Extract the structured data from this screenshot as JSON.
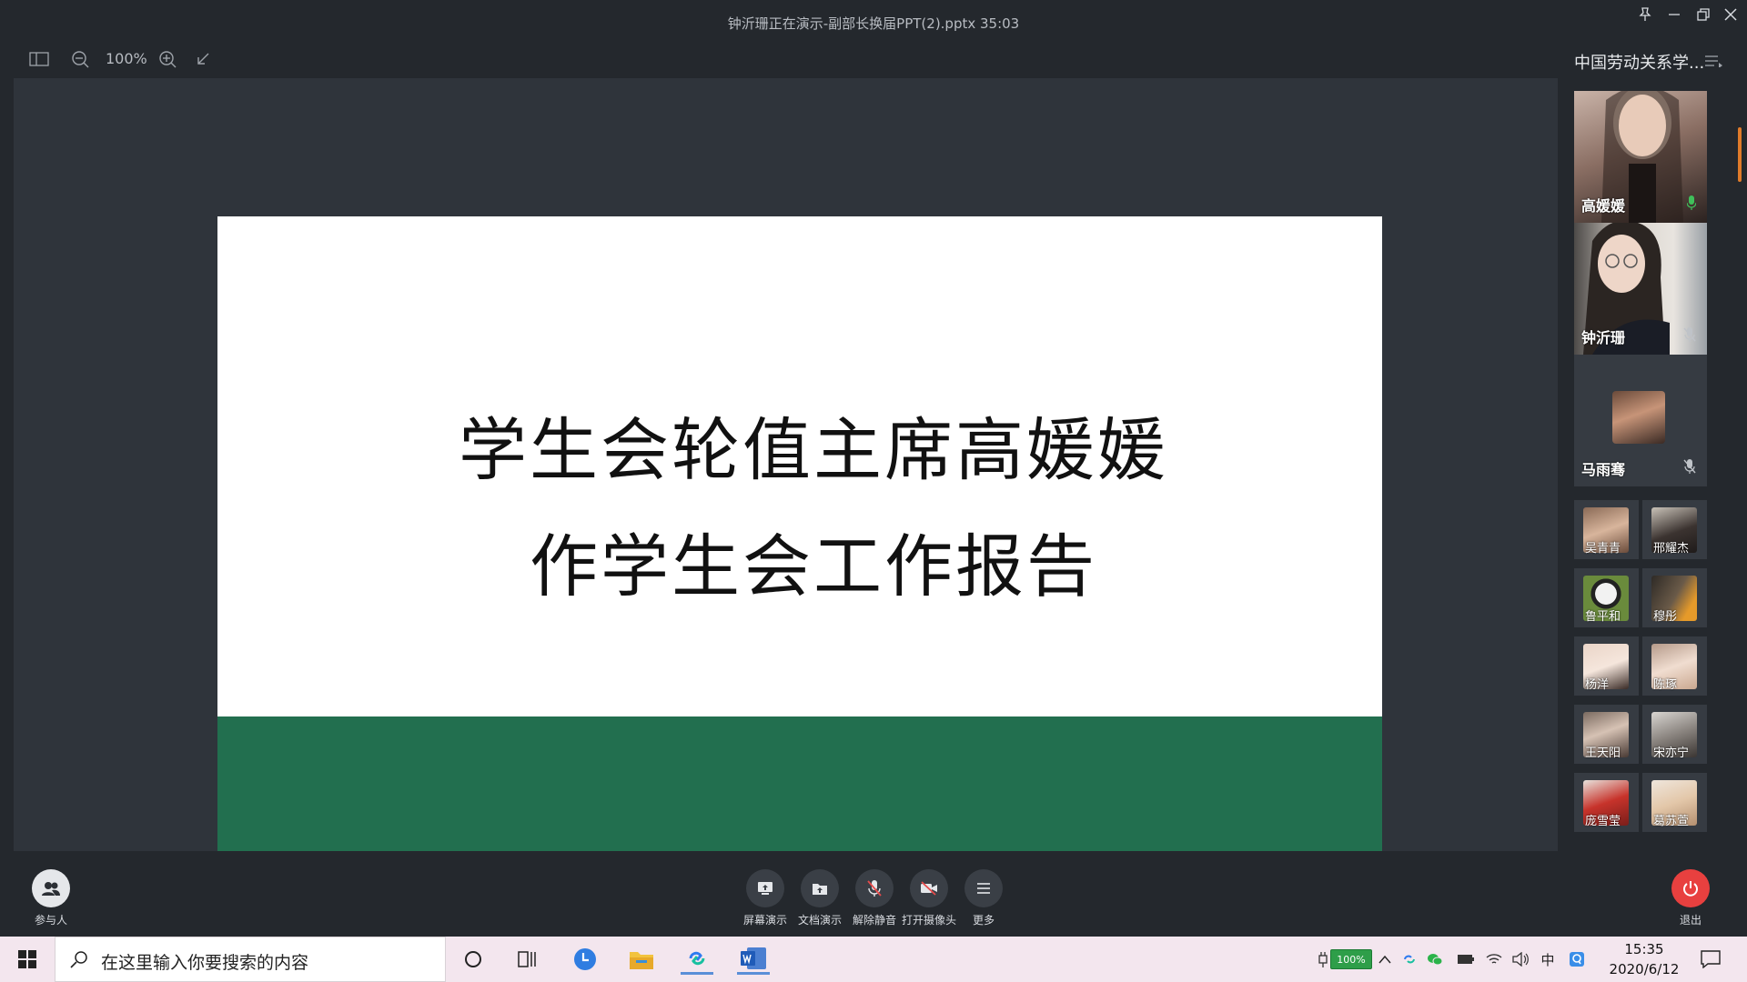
{
  "window": {
    "title": "钟沂珊正在演示-副部长换届PPT(2).pptx 35:03"
  },
  "toolbar": {
    "zoom": "100%"
  },
  "slide": {
    "line1": "学生会轮值主席高媛媛",
    "line2": "作学生会工作报告",
    "band_color": "#226f4f"
  },
  "sidebar": {
    "meeting_name": "中国劳动关系学...",
    "featured": [
      {
        "name": "高媛媛",
        "mic": "on"
      },
      {
        "name": "钟沂珊",
        "mic": "off"
      },
      {
        "name": "马雨骞",
        "mic": "off"
      }
    ],
    "participants": [
      {
        "name": "吴青青"
      },
      {
        "name": "邢耀杰"
      },
      {
        "name": "鲁平和"
      },
      {
        "name": "穆彤"
      },
      {
        "name": "杨洋"
      },
      {
        "name": "陈琢"
      },
      {
        "name": "王天阳"
      },
      {
        "name": "宋亦宁"
      },
      {
        "name": "庞雪莹"
      },
      {
        "name": "葛苏萱"
      }
    ]
  },
  "controls": {
    "participants_label": "参与人",
    "screen_share_label": "屏幕演示",
    "doc_share_label": "文档演示",
    "unmute_label": "解除静音",
    "camera_label": "打开摄像头",
    "more_label": "更多",
    "exit_label": "退出"
  },
  "taskbar": {
    "search_placeholder": "在这里输入你要搜索的内容",
    "battery": "100%",
    "ime": "中",
    "time": "15:35",
    "date": "2020/6/12"
  }
}
